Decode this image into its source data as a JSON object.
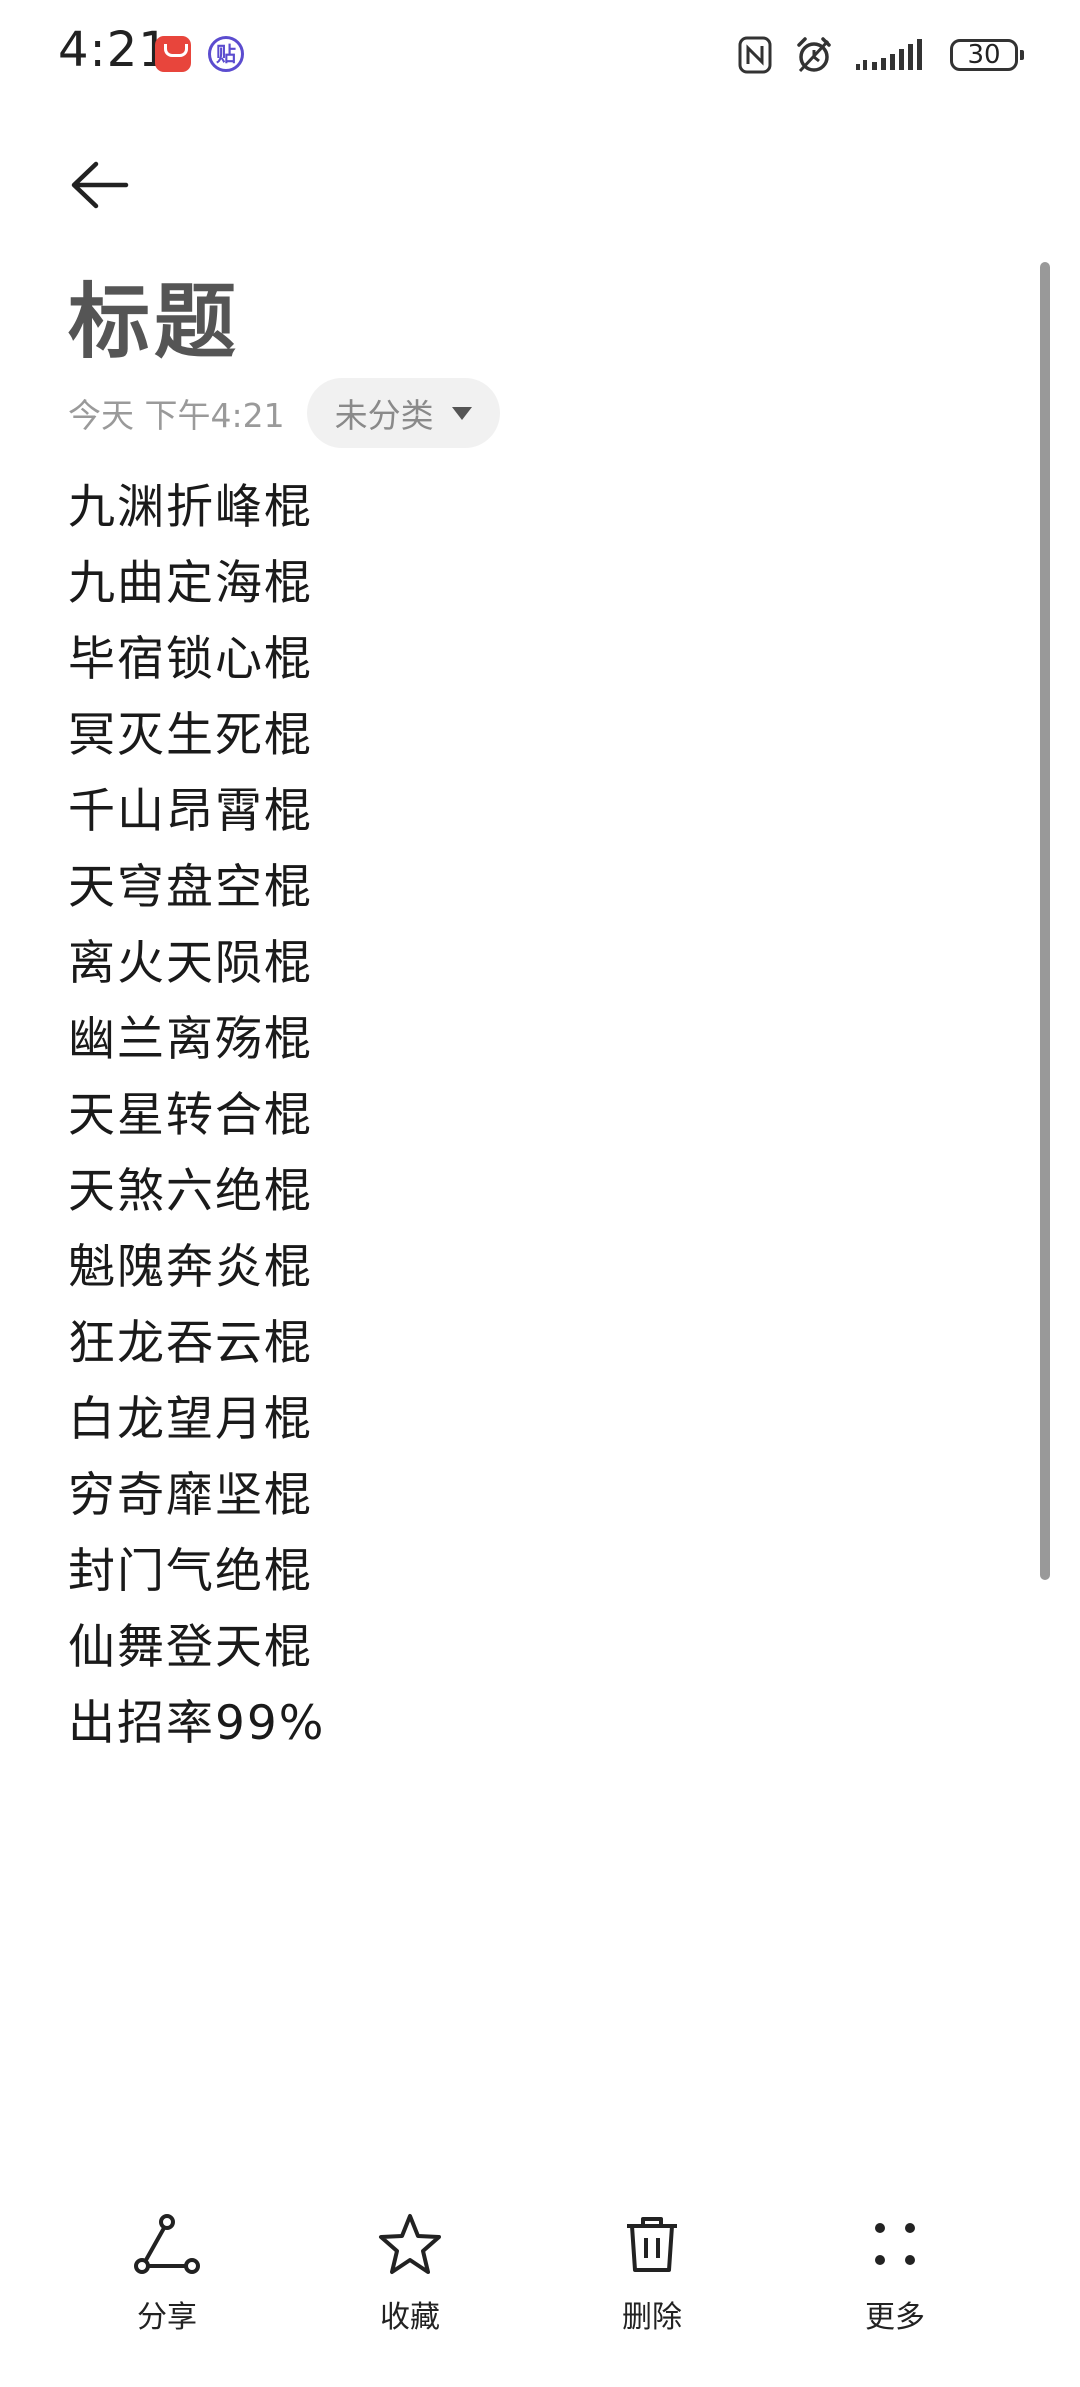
{
  "status_bar": {
    "time": "4:21",
    "badge_text": "贴",
    "battery": "30",
    "icons": [
      "huawei-store-icon",
      "tie-app-icon",
      "nfc-icon",
      "alarm-icon",
      "signal-icon",
      "battery-icon"
    ]
  },
  "header": {
    "back_icon": "arrow-left-icon"
  },
  "note": {
    "title": "标题",
    "date": "今天 下午4:21",
    "category": "未分类",
    "lines": [
      "九渊折峰棍",
      "九曲定海棍",
      "毕宿锁心棍",
      "冥灭生死棍",
      "千山昂霄棍",
      "天穹盘空棍",
      "离火天陨棍",
      "幽兰离殇棍",
      "天星转合棍",
      "天煞六绝棍",
      "魁隗奔炎棍",
      "狂龙吞云棍",
      "白龙望月棍",
      "穷奇靡坚棍",
      "封门气绝棍",
      "仙舞登天棍",
      "出招率99%"
    ]
  },
  "toolbar": {
    "share_label": "分享",
    "favorite_label": "收藏",
    "delete_label": "删除",
    "more_label": "更多"
  }
}
